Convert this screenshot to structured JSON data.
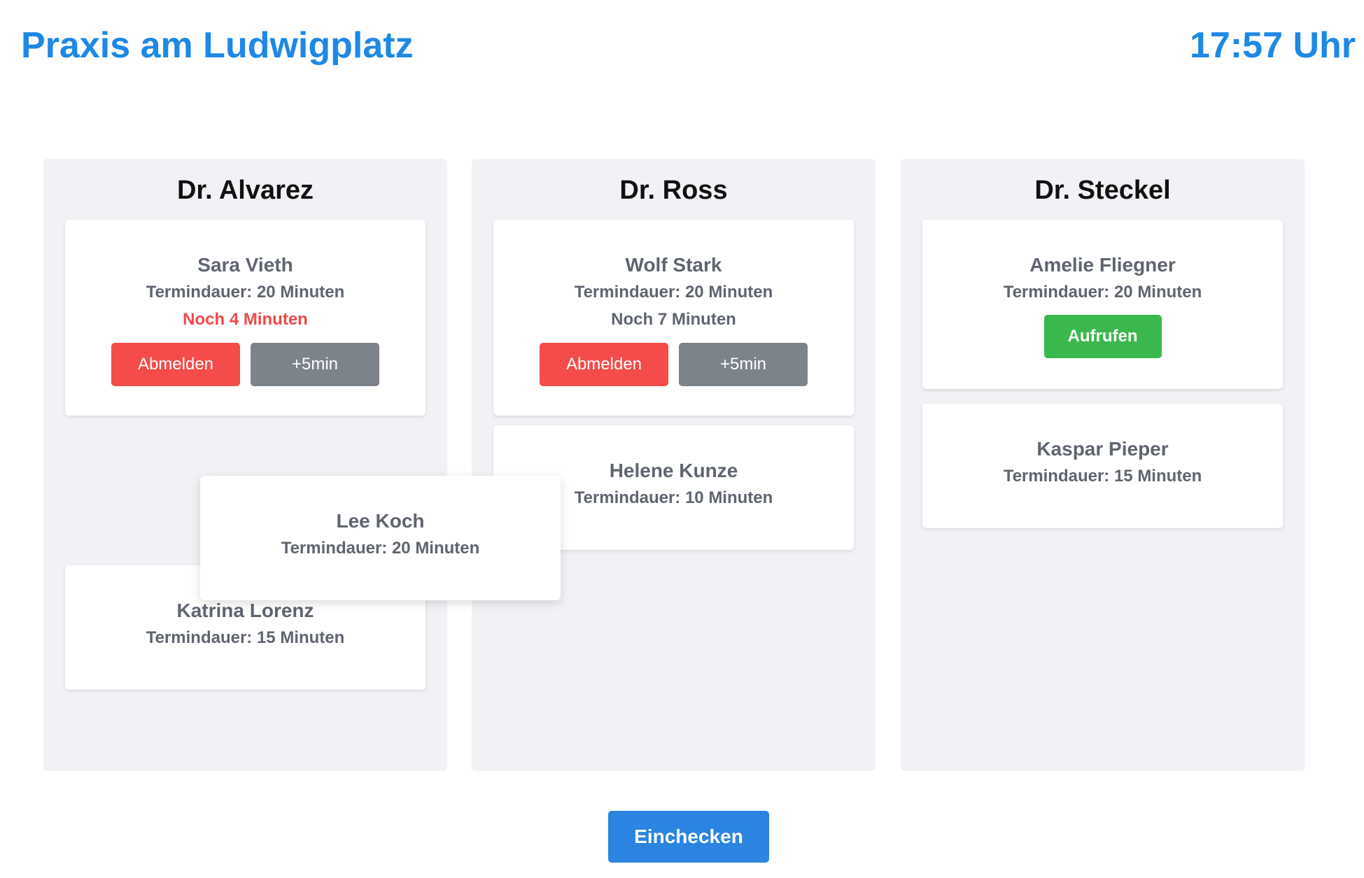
{
  "header": {
    "title": "Praxis am Ludwigplatz",
    "clock": "17:57 Uhr"
  },
  "columns": [
    {
      "doctor": "Dr. Alvarez",
      "cards": [
        {
          "name": "Sara Vieth",
          "duration": "Termindauer: 20 Minuten",
          "remaining": "Noch 4 Minuten",
          "remaining_urgent": true,
          "buttons": {
            "logout": "Abmelden",
            "extend": "+5min"
          }
        },
        {
          "name": "Katrina Lorenz",
          "duration": "Termindauer: 15 Minuten"
        }
      ]
    },
    {
      "doctor": "Dr. Ross",
      "cards": [
        {
          "name": "Wolf Stark",
          "duration": "Termindauer: 20 Minuten",
          "remaining": "Noch 7 Minuten",
          "remaining_urgent": false,
          "buttons": {
            "logout": "Abmelden",
            "extend": "+5min"
          }
        },
        {
          "name": "Helene Kunze",
          "duration": "Termindauer: 10 Minuten"
        }
      ]
    },
    {
      "doctor": "Dr. Steckel",
      "cards": [
        {
          "name": "Amelie Fliegner",
          "duration": "Termindauer: 20 Minuten",
          "buttons": {
            "call": "Aufrufen"
          }
        },
        {
          "name": "Kaspar Pieper",
          "duration": "Termindauer: 15 Minuten"
        }
      ]
    }
  ],
  "dragging_card": {
    "name": "Lee Koch",
    "duration": "Termindauer: 20 Minuten"
  },
  "footer": {
    "checkin_label": "Einchecken"
  },
  "colors": {
    "brand_blue": "#1e88e5",
    "danger_red": "#f54b4b",
    "urgent_text": "#f04848",
    "neutral_grey": "#7c838b",
    "success_green": "#3ab84e",
    "column_bg": "#f1f2f5"
  }
}
